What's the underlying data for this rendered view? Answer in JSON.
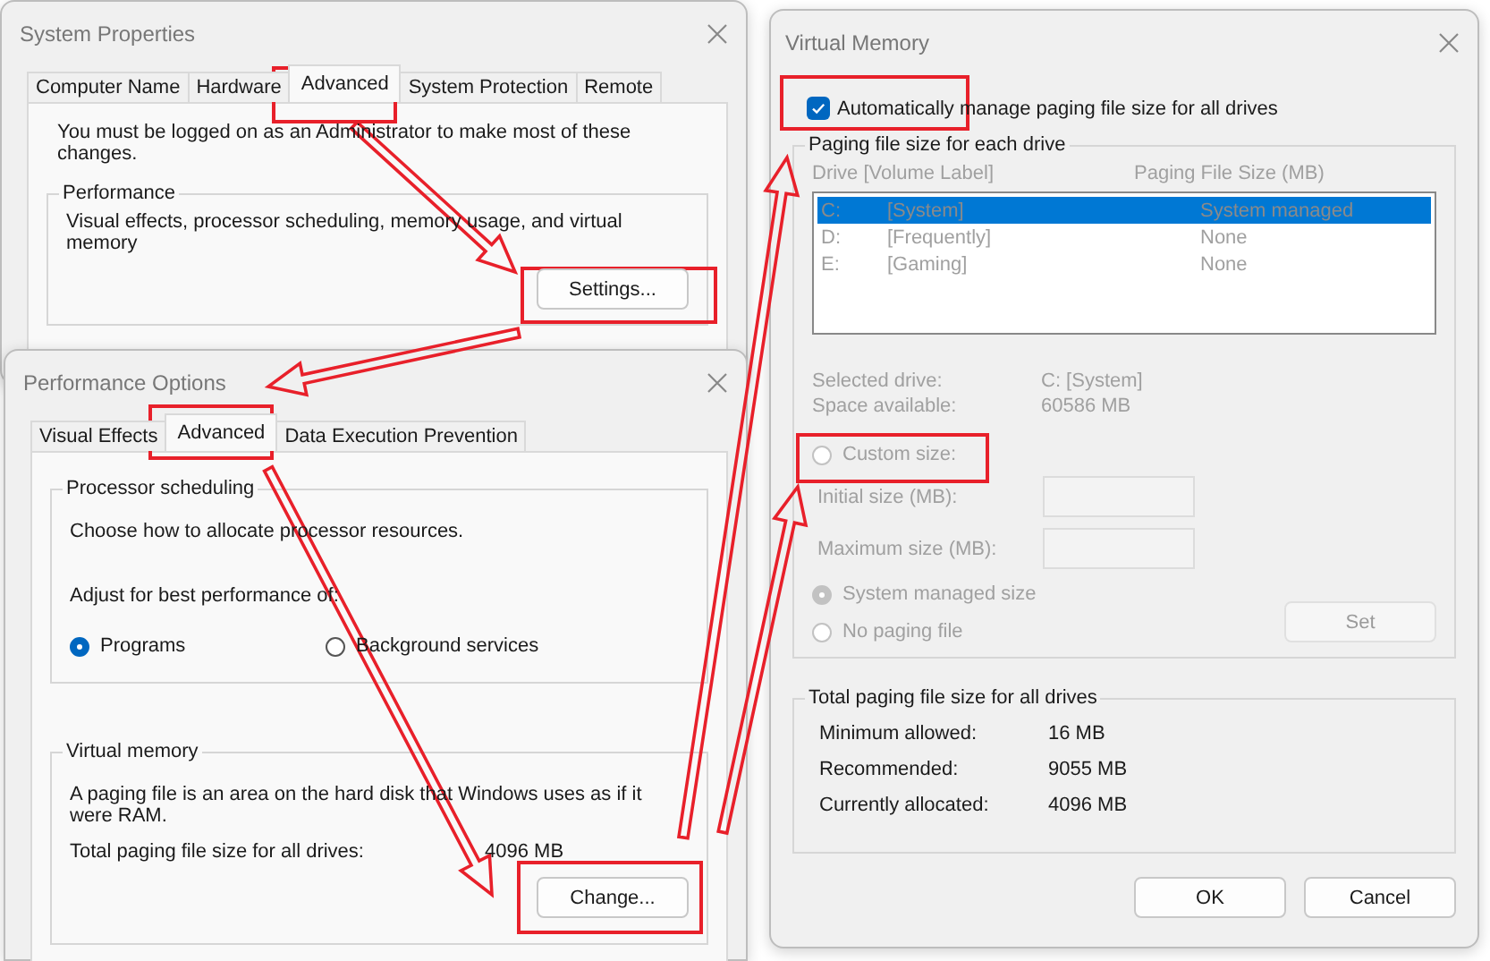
{
  "system_properties": {
    "title": "System Properties",
    "tabs": [
      {
        "label": "Computer Name",
        "selected": false
      },
      {
        "label": "Hardware",
        "selected": false
      },
      {
        "label": "Advanced",
        "selected": true
      },
      {
        "label": "System Protection",
        "selected": false
      },
      {
        "label": "Remote",
        "selected": false
      }
    ],
    "notice": "You must be logged on as an Administrator to make most of these changes.",
    "performance": {
      "legend": "Performance",
      "description": "Visual effects, processor scheduling, memory usage, and virtual memory",
      "button": "Settings..."
    }
  },
  "performance_options": {
    "title": "Performance Options",
    "tabs": [
      {
        "label": "Visual Effects",
        "selected": false
      },
      {
        "label": "Advanced",
        "selected": true
      },
      {
        "label": "Data Execution Prevention",
        "selected": false
      }
    ],
    "processor_scheduling": {
      "legend": "Processor scheduling",
      "description": "Choose how to allocate processor resources.",
      "adjust_label": "Adjust for best performance of:",
      "options": [
        {
          "label": "Programs",
          "selected": true
        },
        {
          "label": "Background services",
          "selected": false
        }
      ]
    },
    "virtual_memory": {
      "legend": "Virtual memory",
      "description": "A paging file is an area on the hard disk that Windows uses as if it were RAM.",
      "total_label": "Total paging file size for all drives:",
      "total_value": "4096 MB",
      "button": "Change..."
    }
  },
  "virtual_memory": {
    "title": "Virtual Memory",
    "auto_manage": {
      "label": "Automatically manage paging file size for all drives",
      "checked": true
    },
    "paging_group": {
      "legend": "Paging file size for each drive",
      "disabled": true,
      "columns": [
        "Drive  [Volume Label]",
        "Paging File Size (MB)"
      ],
      "drives": [
        {
          "drive": "C:",
          "label": "[System]",
          "size": "System managed",
          "selected": true
        },
        {
          "drive": "D:",
          "label": "[Frequently]",
          "size": "None",
          "selected": false
        },
        {
          "drive": "E:",
          "label": "[Gaming]",
          "size": "None",
          "selected": false
        }
      ],
      "selected_drive_label": "Selected drive:",
      "selected_drive_value": "C:  [System]",
      "space_label": "Space available:",
      "space_value": "60586 MB",
      "custom_size": {
        "label": "Custom size:",
        "selected": false
      },
      "initial_label": "Initial size (MB):",
      "maximum_label": "Maximum size (MB):",
      "other_options": [
        {
          "label": "System managed size",
          "selected": true
        },
        {
          "label": "No paging file",
          "selected": false
        }
      ],
      "set_button": "Set"
    },
    "total_group": {
      "legend": "Total paging file size for all drives",
      "rows": [
        {
          "label": "Minimum allowed:",
          "value": "16 MB"
        },
        {
          "label": "Recommended:",
          "value": "9055 MB"
        },
        {
          "label": "Currently allocated:",
          "value": "4096 MB"
        }
      ]
    },
    "buttons": [
      "OK",
      "Cancel"
    ]
  }
}
